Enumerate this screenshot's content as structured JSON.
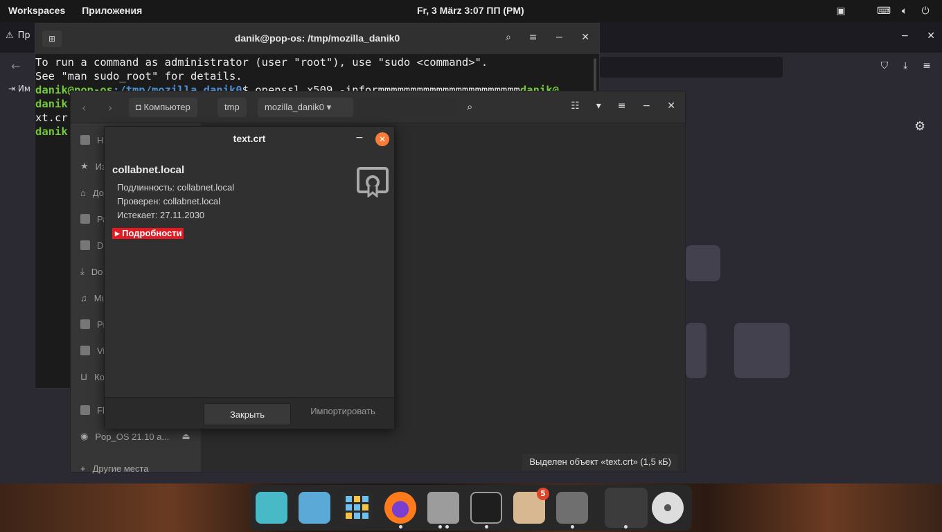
{
  "topbar": {
    "workspaces": "Workspaces",
    "applications": "Приложения",
    "datetime": "Fr, 3 März  3:07 ПП (PM)"
  },
  "firefox": {
    "tab_label": "Пр",
    "bookmark_label": "Им"
  },
  "terminal": {
    "title": "danik@pop-os: /tmp/mozilla_danik0",
    "line1": "To run a command as administrator (user \"root\"), use \"sudo <command>\".",
    "line2": "See \"man sudo_root\" for details.",
    "prompt_user": "danik@pop-os",
    "prompt_path": ":/tmp/mozilla_danik0",
    "prompt_cmd": "$ openssl x509 -informmmmmmmmmmmmmmmmmmmmmm",
    "prompt_user_tail": "danik@",
    "line4_user": "danik",
    "line5": "xt.cr",
    "line6_user": "danik"
  },
  "files": {
    "crumb_computer": "Компьютер",
    "crumb_tmp": "tmp",
    "crumb_folder": "mozilla_danik0",
    "sidebar": [
      {
        "label": "Не"
      },
      {
        "label": "Из"
      },
      {
        "label": "До"
      },
      {
        "label": "Ра"
      },
      {
        "label": "De"
      },
      {
        "label": "Do"
      },
      {
        "label": "Mu"
      },
      {
        "label": "Pi"
      },
      {
        "label": "Vi"
      },
      {
        "label": "Ко"
      },
      {
        "label": "Fl"
      },
      {
        "label": "Pop_OS 21.10 a..."
      },
      {
        "label": "Другие места"
      }
    ],
    "status": "Выделен объект «text.crt»  (1,5 кБ)"
  },
  "dialog": {
    "title": "text.crt",
    "cert_name": "collabnet.local",
    "issued_to": "Подлинность: collabnet.local",
    "verified_by": "Проверен: collabnet.local",
    "expires": "Истекает: 27.11.2030",
    "details_label": "Подробности",
    "close_label": "Закрыть",
    "import_label": "Импортировать"
  },
  "dock": {
    "updates_badge": "5"
  },
  "colors": {
    "accent_orange": "#fb7c38",
    "details_red": "#e01b24",
    "terminal_green": "#73c936",
    "terminal_blue": "#4b8fd6"
  }
}
